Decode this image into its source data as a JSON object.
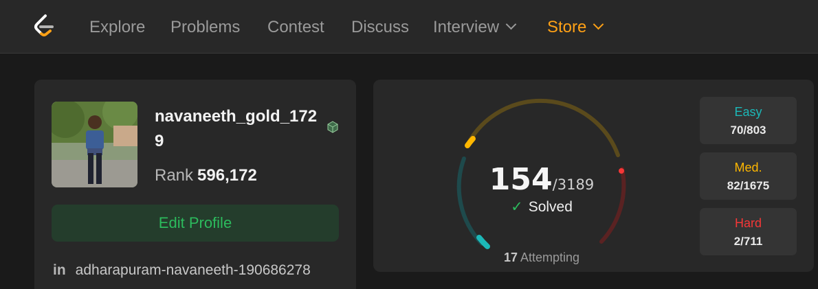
{
  "nav": {
    "items": [
      {
        "label": "Explore"
      },
      {
        "label": "Problems"
      },
      {
        "label": "Contest"
      },
      {
        "label": "Discuss"
      },
      {
        "label": "Interview"
      },
      {
        "label": "Store"
      }
    ]
  },
  "profile": {
    "username": "navaneeth_gold_1729",
    "rank_label": "Rank",
    "rank_value": "596,172",
    "edit_button": "Edit Profile",
    "linkedin_icon": "in",
    "linkedin": "adharapuram-navaneeth-190686278"
  },
  "stats": {
    "solved": "154",
    "total": "/3189",
    "solved_label": "Solved",
    "attempting_count": "17",
    "attempting_label": "Attempting",
    "difficulties": [
      {
        "name": "Easy",
        "value": "70/803",
        "color": "#1cb8b8"
      },
      {
        "name": "Med.",
        "value": "82/1675",
        "color": "#ffb700"
      },
      {
        "name": "Hard",
        "value": "2/711",
        "color": "#f63737"
      }
    ]
  },
  "colors": {
    "brand_orange": "#ffa116",
    "accent_green": "#2cbb5d"
  }
}
